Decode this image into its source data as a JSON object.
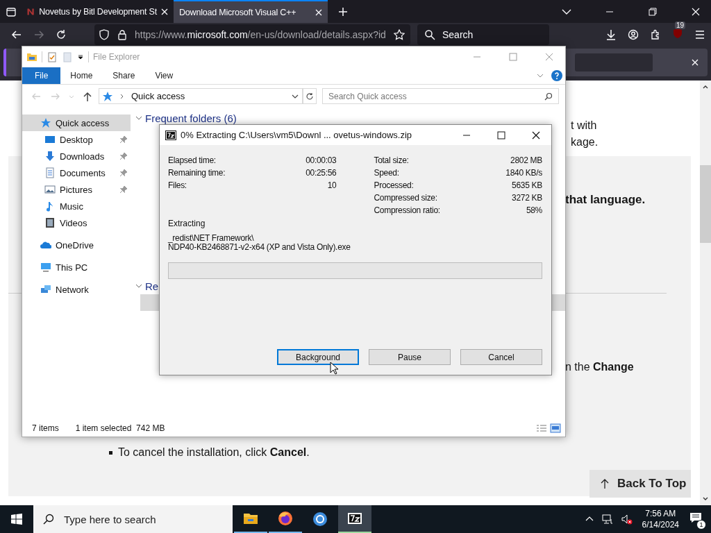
{
  "browser": {
    "tabs": [
      {
        "title": "Novetus by Bitl Development St",
        "selected": false,
        "kind": "novetus"
      },
      {
        "title": "Download Microsoft Visual C++",
        "selected": true,
        "kind": "microsoft"
      }
    ],
    "forward_disabled": true,
    "url": {
      "prefix": "https://www.",
      "domain": "microsoft.com",
      "rest": "/en-us/download/details.aspx?id"
    },
    "search_placeholder": "Search",
    "extension_badge": "19"
  },
  "page": {
    "lines": [
      "t with",
      "kage."
    ],
    "heading": "that language.",
    "instruction": "n the **Change**",
    "bullets": [
      "To cancel the installation, click **Cancel**."
    ],
    "back_to_top": "Back To Top"
  },
  "explorer": {
    "title": "File Explorer",
    "ribbon_tabs": [
      {
        "label": "File",
        "selected": true
      },
      {
        "label": "Home",
        "selected": false
      },
      {
        "label": "Share",
        "selected": false
      },
      {
        "label": "View",
        "selected": false
      }
    ],
    "address": "Quick access",
    "search_placeholder": "Search Quick access",
    "nav": [
      {
        "label": "Quick access",
        "kind": "star",
        "selected": true,
        "children": [
          {
            "label": "Desktop",
            "kind": "desktop",
            "pinned": true,
            "selected": false
          },
          {
            "label": "Downloads",
            "kind": "downloads",
            "pinned": true,
            "selected": false
          },
          {
            "label": "Documents",
            "kind": "documents",
            "pinned": true,
            "selected": false
          },
          {
            "label": "Pictures",
            "kind": "pictures",
            "pinned": true,
            "selected": false
          },
          {
            "label": "Music",
            "kind": "music",
            "pinned": false,
            "selected": false
          },
          {
            "label": "Videos",
            "kind": "videos",
            "pinned": false,
            "selected": false
          }
        ]
      },
      {
        "label": "OneDrive",
        "kind": "onedrive",
        "selected": false
      },
      {
        "label": "This PC",
        "kind": "pc",
        "selected": false
      },
      {
        "label": "Network",
        "kind": "network",
        "selected": false
      }
    ],
    "sections": [
      {
        "title": "Frequent folders (6)",
        "expanded": true
      },
      {
        "title": "Re",
        "expanded": true
      }
    ],
    "status": {
      "count": "7 items",
      "selection": "1 item selected  742 MB"
    }
  },
  "dialog": {
    "title": "0% Extracting C:\\Users\\vm5\\Downl ... ovetus-windows.zip",
    "stats_left": [
      {
        "label": "Elapsed time:",
        "value": "00:00:03"
      },
      {
        "label": "Remaining time:",
        "value": "00:25:56"
      },
      {
        "label": "Files:",
        "value": "10"
      }
    ],
    "stats_right": [
      {
        "label": "Total size:",
        "value": "2802 MB"
      },
      {
        "label": "Speed:",
        "value": "1840 KB/s"
      },
      {
        "label": "Processed:",
        "value": "5635 KB"
      },
      {
        "label": "Compressed size:",
        "value": "3272 KB"
      },
      {
        "label": "Compression ratio:",
        "value": "58%"
      }
    ],
    "status_label": "Extracting",
    "current_file": [
      "_redist\\NET Framework\\",
      "NDP40-KB2468871-v2-x64 (XP and Vista Only).exe"
    ],
    "progress": {
      "level": 0
    },
    "buttons": [
      {
        "label": "Background",
        "focused": true
      },
      {
        "label": "Pause",
        "focused": false
      },
      {
        "label": "Cancel",
        "focused": false
      }
    ]
  },
  "taskbar": {
    "search_placeholder": "Type here to search",
    "apps": [
      {
        "kind": "explorer",
        "running": true,
        "active": false
      },
      {
        "kind": "firefox",
        "running": true,
        "active": false
      },
      {
        "kind": "chrome",
        "running": false,
        "active": false
      },
      {
        "kind": "sevenzip",
        "running": true,
        "active": true
      }
    ],
    "time": "7:56 AM",
    "date": "6/14/2024",
    "notification_count": "1"
  }
}
